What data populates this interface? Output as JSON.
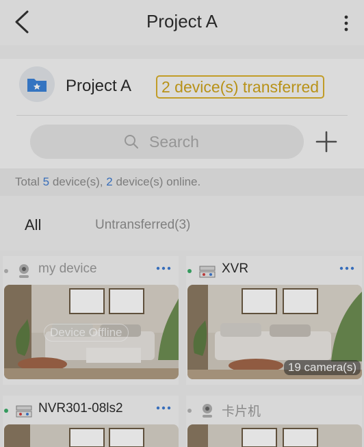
{
  "header": {
    "title": "Project A"
  },
  "project": {
    "name": "Project A",
    "transfer_badge": "2 device(s) transferred"
  },
  "search": {
    "placeholder": "Search"
  },
  "summary": {
    "prefix": "Total ",
    "total": "5",
    "mid": " device(s), ",
    "online": "2",
    "suffix": " device(s) online."
  },
  "tabs": [
    {
      "label": "All"
    },
    {
      "label": "Untransferred(3)"
    }
  ],
  "devices": [
    {
      "name": "my device",
      "status": "offline",
      "overlay": "Device Offline"
    },
    {
      "name": "XVR",
      "status": "online",
      "overlay": "19 camera(s)"
    },
    {
      "name": "NVR301-08ls2",
      "status": "online"
    },
    {
      "name": "卡片机",
      "status": "offline"
    }
  ],
  "colors": {
    "accent_blue": "#3e7bd1",
    "badge_gold": "#cfa41c",
    "online_green": "#3cae6a",
    "offline_gray": "#b5b5b5"
  },
  "icons": {
    "back": "chevron-left-icon",
    "more": "vertical-dots-icon",
    "folder": "folder-star-icon",
    "search": "search-icon",
    "add": "plus-icon"
  }
}
